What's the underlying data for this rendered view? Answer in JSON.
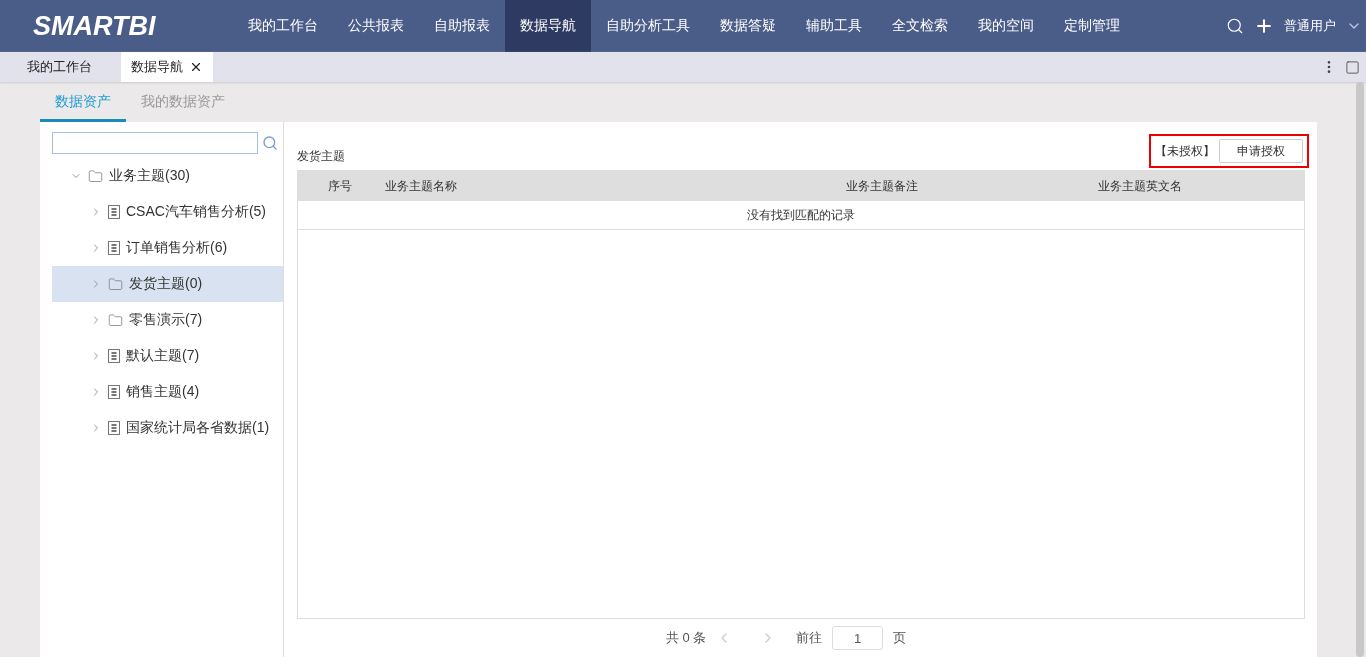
{
  "logo": "SMARTBI",
  "nav": [
    {
      "label": "我的工作台",
      "selected": false
    },
    {
      "label": "公共报表",
      "selected": false
    },
    {
      "label": "自助报表",
      "selected": false
    },
    {
      "label": "数据导航",
      "selected": true
    },
    {
      "label": "自助分析工具",
      "selected": false
    },
    {
      "label": "数据答疑",
      "selected": false
    },
    {
      "label": "辅助工具",
      "selected": false
    },
    {
      "label": "全文检索",
      "selected": false
    },
    {
      "label": "我的空间",
      "selected": false
    },
    {
      "label": "定制管理",
      "selected": false
    }
  ],
  "user": "普通用户",
  "page_tabs": [
    {
      "label": "我的工作台",
      "selected": false,
      "closable": false
    },
    {
      "label": "数据导航",
      "selected": true,
      "closable": true
    }
  ],
  "sub_tabs": [
    {
      "label": "数据资产",
      "selected": true
    },
    {
      "label": "我的数据资产",
      "selected": false
    }
  ],
  "tree": [
    {
      "label": "业务主题(30)",
      "kind": "folder",
      "expanded": true,
      "selected": false,
      "children": [
        {
          "label": "CSAC汽车销售分析(5)",
          "kind": "topic",
          "expanded": false,
          "selected": false
        },
        {
          "label": "订单销售分析(6)",
          "kind": "topic",
          "expanded": false,
          "selected": false
        },
        {
          "label": "发货主题(0)",
          "kind": "folder",
          "expanded": false,
          "selected": true
        },
        {
          "label": "零售演示(7)",
          "kind": "folder",
          "expanded": false,
          "selected": false
        },
        {
          "label": "默认主题(7)",
          "kind": "topic",
          "expanded": false,
          "selected": false
        },
        {
          "label": "销售主题(4)",
          "kind": "topic",
          "expanded": false,
          "selected": false
        },
        {
          "label": "国家统计局各省数据(1)",
          "kind": "topic",
          "expanded": false,
          "selected": false
        }
      ]
    }
  ],
  "detail": {
    "title": "发货主题",
    "auth_status": "【未授权】",
    "apply_button": "申请授权",
    "table": {
      "columns": [
        "序号",
        "业务主题名称",
        "业务主题备注",
        "业务主题英文名"
      ],
      "empty_message": "没有找到匹配的记录"
    },
    "pager": {
      "total": "共 0 条",
      "goto_label": "前往",
      "page": "1",
      "page_suffix": "页"
    }
  }
}
